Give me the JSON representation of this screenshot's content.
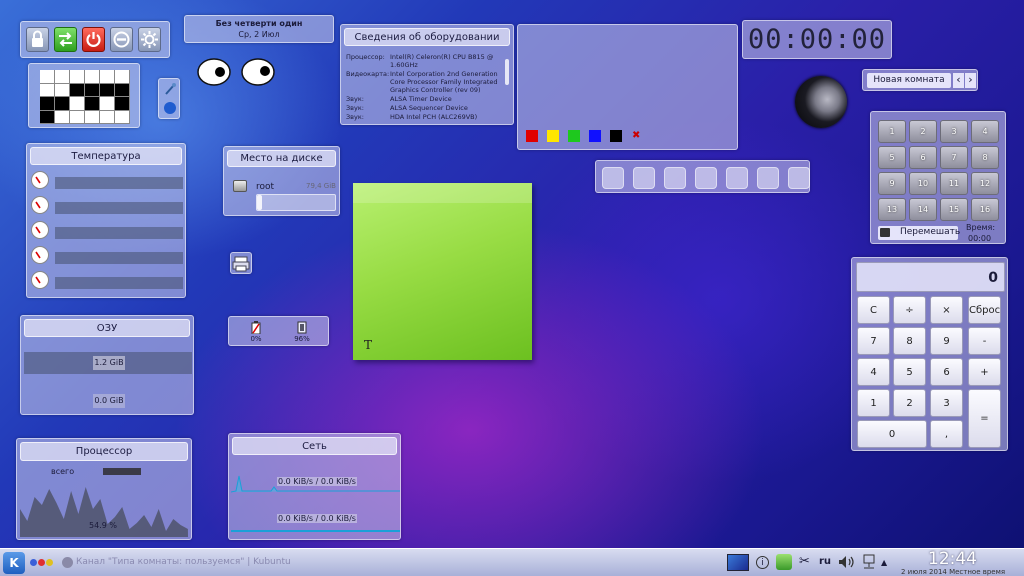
{
  "date_widget": {
    "title": "Без четверти один",
    "date": "Ср, 2 Июл"
  },
  "hardware": {
    "title": "Сведения об оборудовании",
    "rows": [
      {
        "label": "Процессор:",
        "value": "Intel(R) Celeron(R) CPU B815 @ 1.60GHz"
      },
      {
        "label": "Видеокарта:",
        "value": "Intel Corporation 2nd Generation Core Processor Family Integrated Graphics Controller (rev 09)"
      },
      {
        "label": "Звук:",
        "value": "ALSA Timer Device"
      },
      {
        "label": "Звук:",
        "value": "ALSA Sequencer Device"
      },
      {
        "label": "Звук:",
        "value": "HDA Intel PCH (ALC269VB)"
      }
    ]
  },
  "timer": {
    "value": "00:00:00"
  },
  "activity": {
    "label": "Новая комната",
    "prev": "‹",
    "next": "›"
  },
  "temperature": {
    "title": "Температура",
    "sensors": 5
  },
  "disk": {
    "title": "Место на диске",
    "name": "root",
    "size": "79,4 GiB",
    "used_fraction": 0.06
  },
  "battery": {
    "battery_pct": "0%",
    "mem_pct": "96%"
  },
  "ram": {
    "title": "ОЗУ",
    "used": "1.2 GiB",
    "swap": "0.0 GiB"
  },
  "cpu": {
    "title": "Процессор",
    "total_label": "всего",
    "value": "54.9 %"
  },
  "network": {
    "title": "Сеть",
    "rx": "0.0 KiB/s / 0.0 KiB/s",
    "tx": "0.0 KiB/s / 0.0 KiB/s"
  },
  "note": {
    "text_icon": "T"
  },
  "fifteen": {
    "tiles": [
      "1",
      "2",
      "3",
      "4",
      "5",
      "6",
      "7",
      "8",
      "9",
      "10",
      "11",
      "12",
      "13",
      "14",
      "15",
      "16"
    ],
    "shuffle": "Перемешать",
    "time_label": "Время:",
    "time": "00:00"
  },
  "calculator": {
    "display": "0",
    "keys": {
      "c": "C",
      "div": "÷",
      "mul": "×",
      "reset": "Сброс",
      "k7": "7",
      "k8": "8",
      "k9": "9",
      "minus": "-",
      "k4": "4",
      "k5": "5",
      "k6": "6",
      "plus": "+",
      "k1": "1",
      "k2": "2",
      "k3": "3",
      "eq": "=",
      "k0": "0",
      "dot": ","
    }
  },
  "taskbar": {
    "task": "Канал \"Типа комнаты: пользуемся\" | Kubuntu",
    "lang": "ru",
    "clock": "12:44",
    "date": "2 июля 2014 Местное время"
  },
  "colors": {
    "note": "#8ed33a",
    "accent": "#3b3fc4"
  },
  "swatches": [
    "#e00000",
    "#ffe600",
    "#1ec81e",
    "#1010ff",
    "#000000"
  ],
  "icons": {
    "lock": "lock-icon",
    "switch": "switch-user-icon",
    "power": "power-icon",
    "logout": "logout-icon",
    "settings": "settings-icon"
  }
}
